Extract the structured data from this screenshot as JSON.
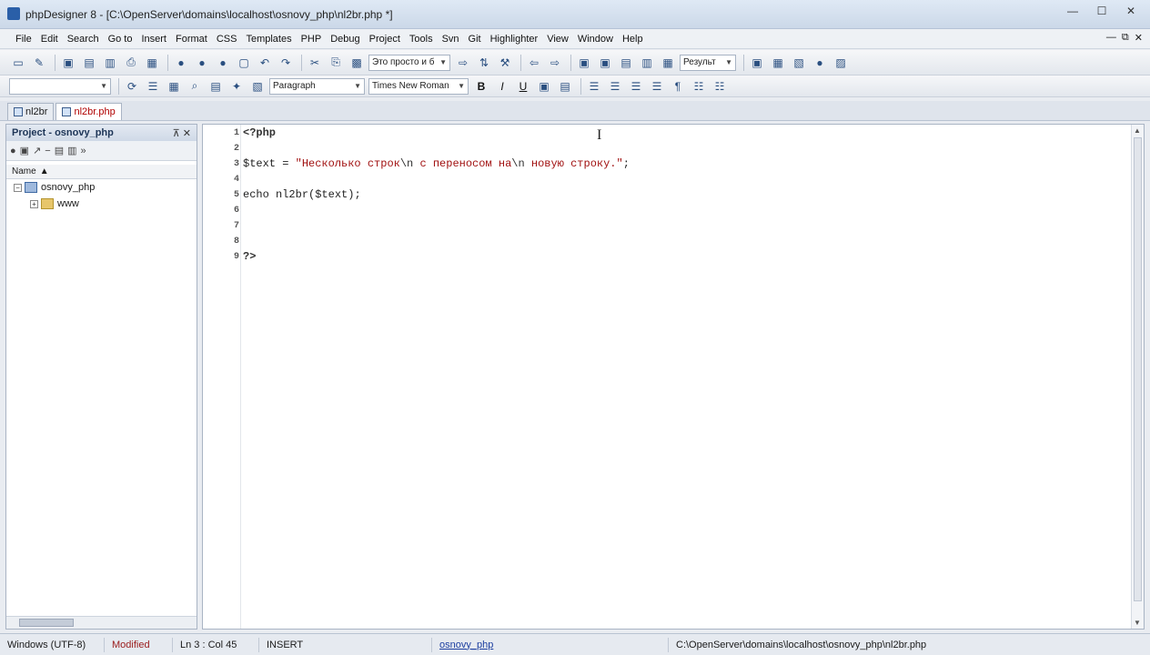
{
  "window": {
    "title": "phpDesigner 8 - [C:\\OpenServer\\domains\\localhost\\osnovy_php\\nl2br.php *]"
  },
  "menu": [
    "File",
    "Edit",
    "Search",
    "Go to",
    "Insert",
    "Format",
    "CSS",
    "Templates",
    "PHP",
    "Debug",
    "Project",
    "Tools",
    "Svn",
    "Git",
    "Highlighter",
    "View",
    "Window",
    "Help"
  ],
  "toolbar": {
    "text_combo": "Это просто и б",
    "paragraph_combo": "Paragraph",
    "font_combo": "Times New Roman",
    "style_label": "Результ",
    "bold": "B",
    "italic": "I",
    "underline": "U"
  },
  "tabs": [
    {
      "label": "nl2br",
      "active": false
    },
    {
      "label": "nl2br.php",
      "active": true
    }
  ],
  "project_panel": {
    "title": "Project - osnovy_php",
    "controls": "⊼ ✕",
    "column_header": "Name",
    "tree": [
      {
        "label": "osnovy_php",
        "level": 0,
        "expander": "−",
        "icon": "project-icon"
      },
      {
        "label": "www",
        "level": 1,
        "expander": "+",
        "icon": "folder-icon"
      }
    ]
  },
  "editor": {
    "lines": [
      {
        "n": "1",
        "tokens": [
          {
            "t": "<?php",
            "c": "tok-tag"
          }
        ]
      },
      {
        "n": "2",
        "tokens": []
      },
      {
        "n": "3",
        "tokens": [
          {
            "t": "$text",
            "c": "tok-var"
          },
          {
            "t": " = ",
            "c": "tok-plain"
          },
          {
            "t": "\"Несколько строк",
            "c": "tok-str"
          },
          {
            "t": "\\n",
            "c": "tok-esc"
          },
          {
            "t": " с переносом на",
            "c": "tok-str"
          },
          {
            "t": "\\n",
            "c": "tok-esc"
          },
          {
            "t": " новую строку.\"",
            "c": "tok-str"
          },
          {
            "t": ";",
            "c": "tok-plain"
          }
        ]
      },
      {
        "n": "4",
        "tokens": []
      },
      {
        "n": "5",
        "tokens": [
          {
            "t": "echo ",
            "c": "tok-plain"
          },
          {
            "t": "nl2br",
            "c": "tok-fn"
          },
          {
            "t": "(",
            "c": "tok-plain"
          },
          {
            "t": "$text",
            "c": "tok-var"
          },
          {
            "t": ");",
            "c": "tok-plain"
          }
        ]
      },
      {
        "n": "6",
        "tokens": []
      },
      {
        "n": "7",
        "tokens": []
      },
      {
        "n": "8",
        "tokens": []
      },
      {
        "n": "9",
        "tokens": [
          {
            "t": "?>",
            "c": "tok-tag"
          }
        ]
      }
    ]
  },
  "statusbar": {
    "encoding": "Windows (UTF-8)",
    "modified": "Modified",
    "position": "Ln 3 : Col 45",
    "mode": "INSERT",
    "project": "osnovy_php",
    "path": "C:\\OpenServer\\domains\\localhost\\osnovy_php\\nl2br.php"
  }
}
